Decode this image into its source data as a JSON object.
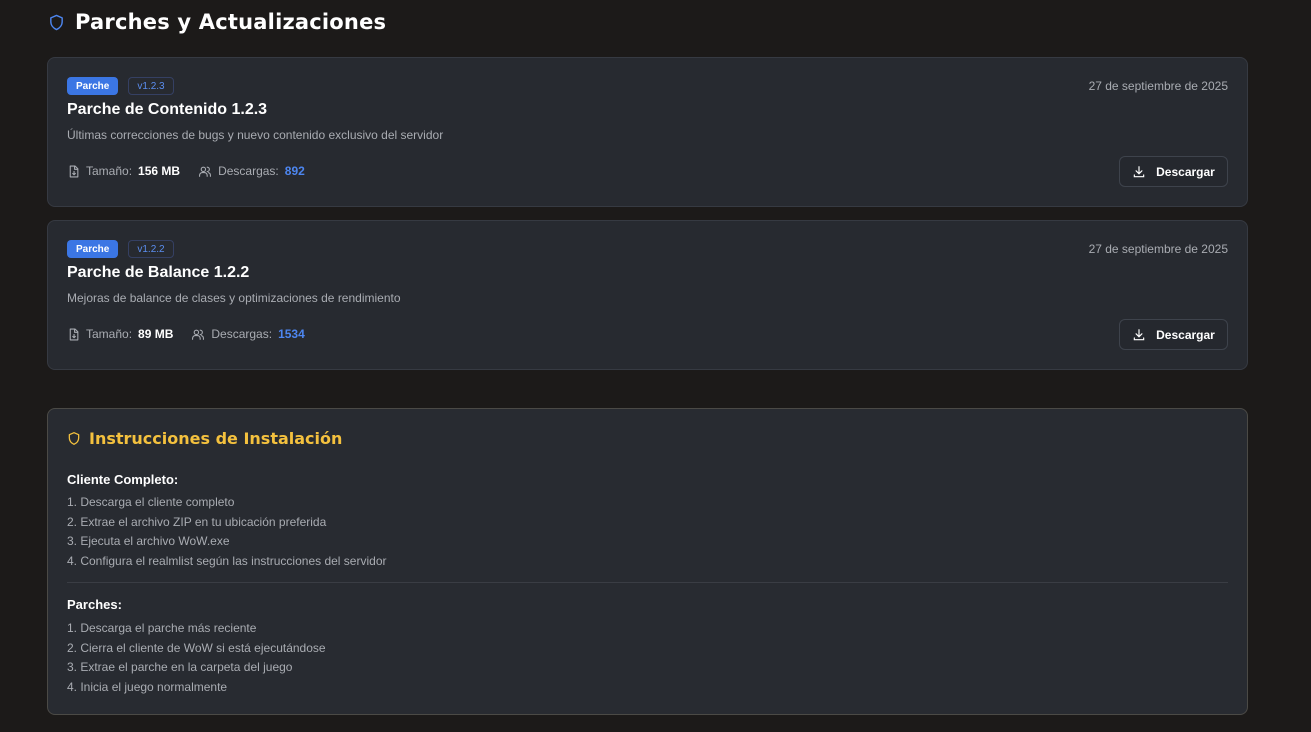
{
  "header": {
    "title": "Parches y Actualizaciones",
    "icon": "shield-icon",
    "icon_color": "#4d86f0"
  },
  "patches": [
    {
      "badge": "Parche",
      "version": "v1.2.3",
      "date": "27 de septiembre de 2025",
      "title": "Parche de Contenido 1.2.3",
      "description": "Últimas correcciones de bugs y nuevo contenido exclusivo del servidor",
      "size_label": "Tamaño:",
      "size_value": "156 MB",
      "downloads_label": "Descargas:",
      "downloads_value": "892",
      "button_label": "Descargar"
    },
    {
      "badge": "Parche",
      "version": "v1.2.2",
      "date": "27 de septiembre de 2025",
      "title": "Parche de Balance 1.2.2",
      "description": "Mejoras de balance de clases y optimizaciones de rendimiento",
      "size_label": "Tamaño:",
      "size_value": "89 MB",
      "downloads_label": "Descargas:",
      "downloads_value": "1534",
      "button_label": "Descargar"
    }
  ],
  "instructions": {
    "title": "Instrucciones de Instalación",
    "icon": "shield-icon",
    "accent_color": "#f4c13e",
    "sections": [
      {
        "title": "Cliente Completo:",
        "steps": [
          "1. Descarga el cliente completo",
          "2. Extrae el archivo ZIP en tu ubicación preferida",
          "3. Ejecuta el archivo WoW.exe",
          "4. Configura el realmlist según las instrucciones del servidor"
        ]
      },
      {
        "title": "Parches:",
        "steps": [
          "1. Descarga el parche más reciente",
          "2. Cierra el cliente de WoW si está ejecutándose",
          "3. Extrae el parche en la carpeta del juego",
          "4. Inicia el juego normalmente"
        ]
      }
    ]
  },
  "colors": {
    "background": "#1c1a19",
    "card": "#272a30",
    "badge_blue": "#3b76e4",
    "downloads_blue": "#4d86f0"
  }
}
